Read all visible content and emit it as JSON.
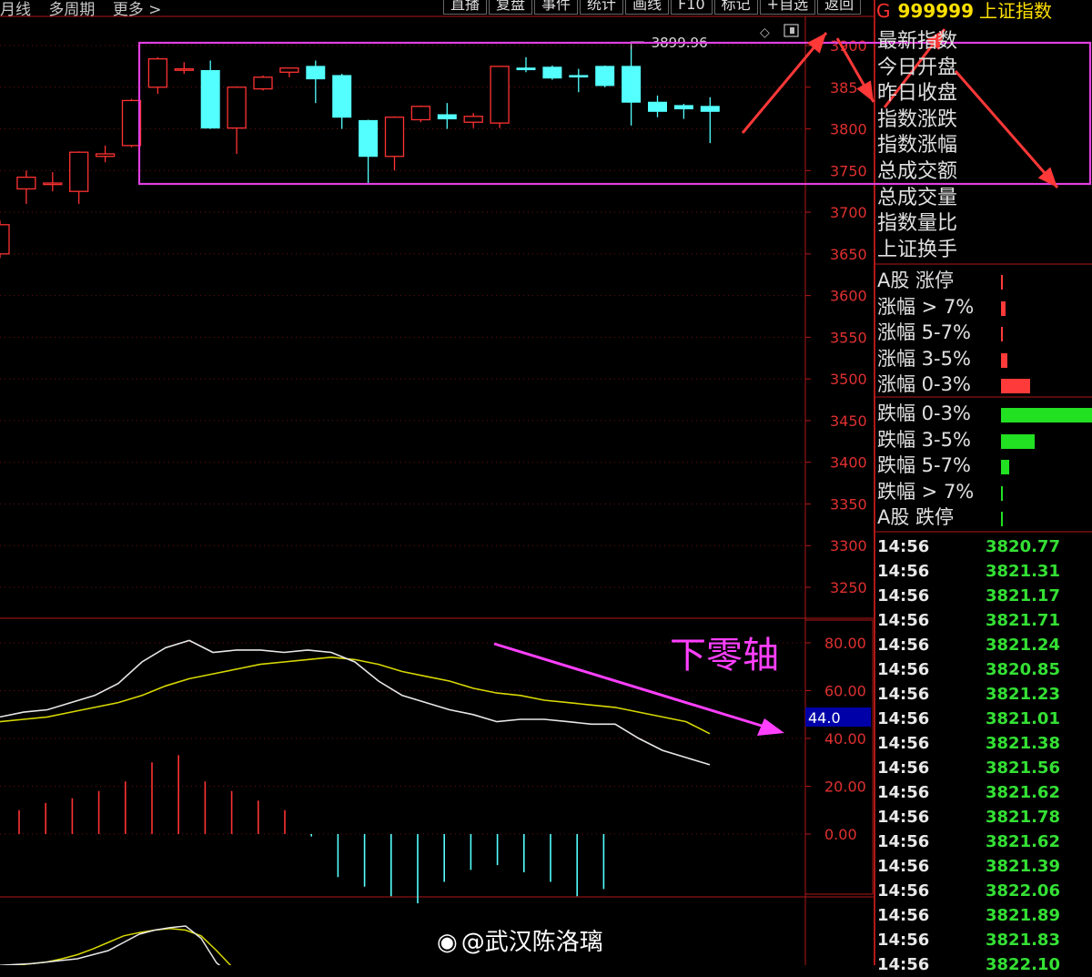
{
  "toolbar": {
    "left": [
      "月线",
      "多周期",
      "更多 >"
    ],
    "right": [
      "直播",
      "复盘",
      "事件",
      "统计",
      "画线",
      "F10",
      "标记",
      "+自选",
      "返回"
    ]
  },
  "header": {
    "g": "G",
    "code": "999999",
    "name": "上证指数"
  },
  "fields": [
    "最新指数",
    "今日开盘",
    "昨日收盘",
    "指数涨跌",
    "指数涨幅",
    "总成交额",
    "总成交量",
    "指数量比",
    "上证换手"
  ],
  "distribution_up": [
    {
      "label": "A股 涨停",
      "value": 0.01
    },
    {
      "label": "涨幅 > 7%",
      "value": 0.05
    },
    {
      "label": "涨幅 5-7%",
      "value": 0.01
    },
    {
      "label": "涨幅 3-5%",
      "value": 0.07
    },
    {
      "label": "涨幅 0-3%",
      "value": 0.32
    }
  ],
  "distribution_down": [
    {
      "label": "跌幅 0-3%",
      "value": 1.0
    },
    {
      "label": "跌幅 3-5%",
      "value": 0.37
    },
    {
      "label": "跌幅 5-7%",
      "value": 0.09
    },
    {
      "label": "跌幅 > 7%",
      "value": 0.01
    },
    {
      "label": "A股 跌停",
      "value": 0.01
    }
  ],
  "tick_trades": [
    {
      "time": "14:56",
      "price": "3820.77"
    },
    {
      "time": "14:56",
      "price": "3821.31"
    },
    {
      "time": "14:56",
      "price": "3821.17"
    },
    {
      "time": "14:56",
      "price": "3821.71"
    },
    {
      "time": "14:56",
      "price": "3821.24"
    },
    {
      "time": "14:56",
      "price": "3820.85"
    },
    {
      "time": "14:56",
      "price": "3821.23"
    },
    {
      "time": "14:56",
      "price": "3821.01"
    },
    {
      "time": "14:56",
      "price": "3821.38"
    },
    {
      "time": "14:56",
      "price": "3821.56"
    },
    {
      "time": "14:56",
      "price": "3821.62"
    },
    {
      "time": "14:56",
      "price": "3821.78"
    },
    {
      "time": "14:56",
      "price": "3821.62"
    },
    {
      "time": "14:56",
      "price": "3821.39"
    },
    {
      "time": "14:56",
      "price": "3822.06"
    },
    {
      "time": "14:56",
      "price": "3821.89"
    },
    {
      "time": "14:56",
      "price": "3821.83"
    },
    {
      "time": "14:56",
      "price": "3822.10"
    }
  ],
  "annotation": "下零轴",
  "watermark": "@武汉陈洛璃",
  "colors": {
    "up": "#ff3232",
    "down": "#54ffff",
    "annotation": "#ff40ff",
    "highlight_box": "#e040e0",
    "fast_line": "#e8e8e8",
    "slow_line": "#d8d800"
  },
  "chart_data": [
    {
      "type": "candlestick",
      "y_ticks": [
        3900,
        3850,
        3800,
        3750,
        3700,
        3650,
        3600,
        3550,
        3500,
        3450,
        3400,
        3350,
        3300,
        3250
      ],
      "y_tick_labels": [
        "3900",
        "385",
        "3800",
        "3750",
        "3700",
        "3650",
        "3600",
        "3550",
        "3500",
        "3450",
        "3400",
        "3350",
        "3300",
        "3250"
      ],
      "ylim": [
        3210,
        3935
      ],
      "high_marker": {
        "label": "3899.96",
        "value": 3899.96
      },
      "candles": [
        {
          "o": 3650,
          "c": 3685,
          "h": 3690,
          "l": 3645
        },
        {
          "o": 3728,
          "c": 3742,
          "h": 3750,
          "l": 3710
        },
        {
          "o": 3735,
          "c": 3735,
          "h": 3748,
          "l": 3725
        },
        {
          "o": 3725,
          "c": 3772,
          "h": 3773,
          "l": 3710
        },
        {
          "o": 3767,
          "c": 3770,
          "h": 3780,
          "l": 3760
        },
        {
          "o": 3780,
          "c": 3834,
          "h": 3836,
          "l": 3778
        },
        {
          "o": 3850,
          "c": 3884,
          "h": 3886,
          "l": 3842
        },
        {
          "o": 3872,
          "c": 3872,
          "h": 3880,
          "l": 3866
        },
        {
          "o": 3870,
          "c": 3801,
          "h": 3882,
          "l": 3800
        },
        {
          "o": 3801,
          "c": 3850,
          "h": 3851,
          "l": 3770
        },
        {
          "o": 3848,
          "c": 3862,
          "h": 3864,
          "l": 3846
        },
        {
          "o": 3868,
          "c": 3873,
          "h": 3873,
          "l": 3862
        },
        {
          "o": 3875,
          "c": 3860,
          "h": 3882,
          "l": 3831
        },
        {
          "o": 3864,
          "c": 3814,
          "h": 3866,
          "l": 3800
        },
        {
          "o": 3810,
          "c": 3767,
          "h": 3811,
          "l": 3733
        },
        {
          "o": 3767,
          "c": 3814,
          "h": 3815,
          "l": 3750
        },
        {
          "o": 3811,
          "c": 3827,
          "h": 3828,
          "l": 3808
        },
        {
          "o": 3817,
          "c": 3812,
          "h": 3831,
          "l": 3800
        },
        {
          "o": 3808,
          "c": 3815,
          "h": 3819,
          "l": 3801
        },
        {
          "o": 3807,
          "c": 3875,
          "h": 3875,
          "l": 3801
        },
        {
          "o": 3873,
          "c": 3871,
          "h": 3886,
          "l": 3868
        },
        {
          "o": 3874,
          "c": 3861,
          "h": 3876,
          "l": 3859
        },
        {
          "o": 3864,
          "c": 3863,
          "h": 3872,
          "l": 3844
        },
        {
          "o": 3875,
          "c": 3852,
          "h": 3876,
          "l": 3850
        },
        {
          "o": 3875,
          "c": 3832,
          "h": 3899.96,
          "l": 3804
        },
        {
          "o": 3832,
          "c": 3821,
          "h": 3840,
          "l": 3814
        },
        {
          "o": 3828,
          "c": 3824,
          "h": 3830,
          "l": 3812
        },
        {
          "o": 3827,
          "c": 3821,
          "h": 3838,
          "l": 3783
        }
      ]
    },
    {
      "type": "line",
      "y_ticks": [
        80,
        60,
        40,
        20,
        0
      ],
      "y_tick_labels": [
        "80.00",
        "60.00",
        "40.00",
        "20.00",
        "0.00"
      ],
      "ylim": [
        -23,
        89
      ],
      "current_label": "44.0",
      "series": [
        {
          "values": [
            49,
            51,
            52,
            55,
            58,
            63,
            72,
            78,
            81,
            76,
            77,
            77,
            76,
            77,
            76,
            72,
            64,
            58,
            55,
            52,
            50,
            47,
            48,
            48,
            47,
            46,
            46,
            40,
            35,
            32,
            29
          ]
        },
        {
          "values": [
            47,
            48,
            49,
            51,
            53,
            55,
            58,
            62,
            65,
            67,
            69,
            71,
            72,
            73,
            74,
            73,
            71,
            68,
            66,
            64,
            61,
            59,
            58,
            56,
            55,
            54,
            53,
            51,
            49,
            47,
            42
          ]
        },
        {
          "values": [
            10,
            13,
            15,
            18,
            22,
            30,
            33,
            22,
            18,
            14,
            10,
            -1,
            -18,
            -22,
            -26,
            -29,
            -20,
            -15,
            -13,
            -16,
            -20,
            -26,
            -23
          ]
        }
      ]
    }
  ]
}
